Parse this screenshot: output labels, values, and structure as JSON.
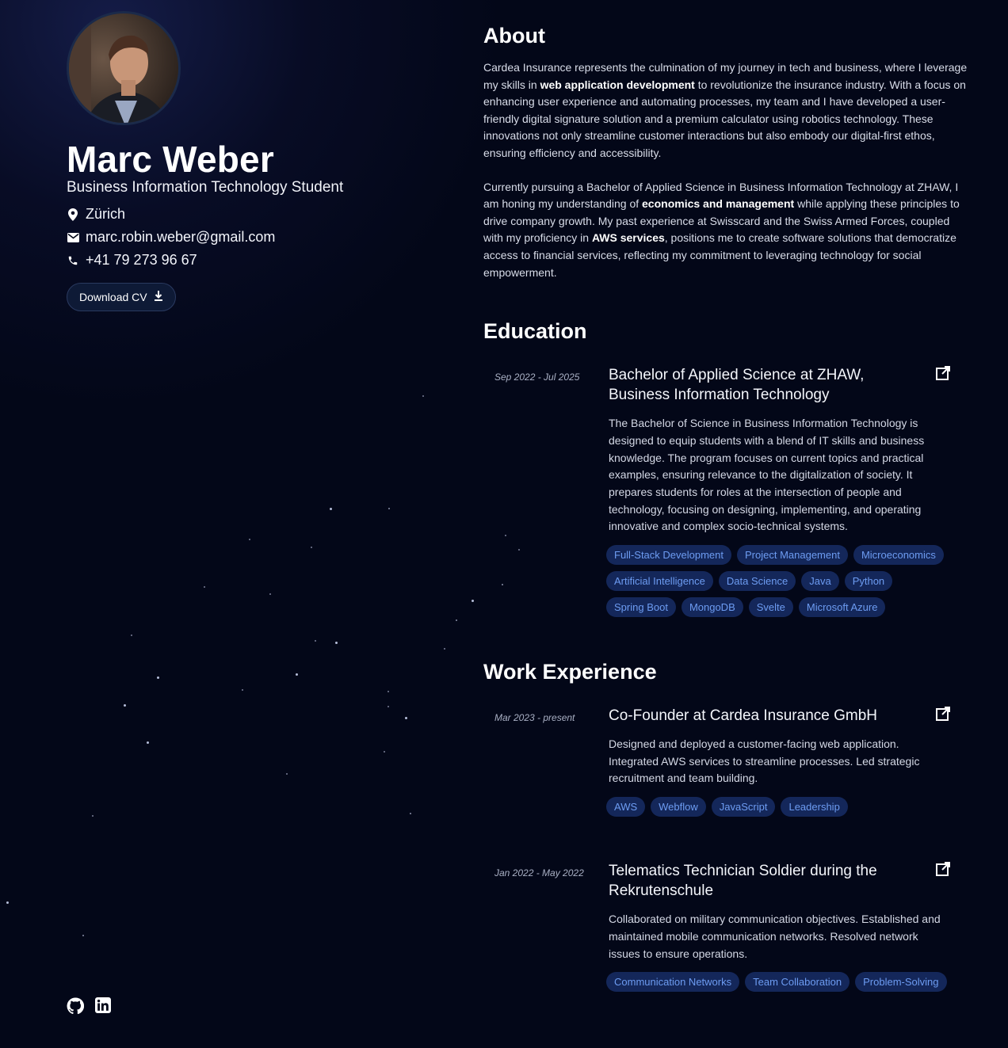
{
  "profile": {
    "name": "Marc Weber",
    "subtitle": "Business Information Technology Student",
    "location": "Zürich",
    "email": "marc.robin.weber@gmail.com",
    "phone": "+41 79 273 96 67",
    "download_label": "Download CV",
    "icons": {
      "location": "map-pin-icon",
      "email": "mail-icon",
      "phone": "phone-icon",
      "download": "download-icon"
    }
  },
  "socials": [
    {
      "icon": "github-icon"
    },
    {
      "icon": "linkedin-icon"
    }
  ],
  "about": {
    "heading": "About",
    "p1_a": "Cardea Insurance represents the culmination of my journey in tech and business, where I leverage my skills in ",
    "p1_b": "web application development",
    "p1_c": " to revolutionize the insurance industry. With a focus on enhancing user experience and automating processes, my team and I have developed a user-friendly digital signature solution and a premium calculator using robotics technology. These innovations not only streamline customer interactions but also embody our digital-first ethos, ensuring efficiency and accessibility.",
    "p2_a": "Currently pursuing a Bachelor of Applied Science in Business Information Technology at ZHAW, I am honing my understanding of ",
    "p2_b": "economics and management",
    "p2_c": " while applying these principles to drive company growth. My past experience at Swisscard and the Swiss Armed Forces, coupled with my proficiency in ",
    "p2_d": "AWS services",
    "p2_e": ", positions me to create software solutions that democratize access to financial services, reflecting my commitment to leveraging technology for social empowerment."
  },
  "education": {
    "heading": "Education",
    "items": [
      {
        "date": "Sep 2022 - Jul 2025",
        "title": "Bachelor of Applied Science at ZHAW, Business Information Technology",
        "description": "The Bachelor of Science in Business Information Technology is designed to equip students with a blend of IT skills and business knowledge. The program focuses on current topics and practical examples, ensuring relevance to the digitalization of society. It prepares students for roles at the intersection of people and technology, focusing on designing, implementing, and operating innovative and complex socio-technical systems.",
        "tags": [
          "Full-Stack Development",
          "Project Management",
          "Microeconomics",
          "Artificial Intelligence",
          "Data Science",
          "Java",
          "Python",
          "Spring Boot",
          "MongoDB",
          "Svelte",
          "Microsoft Azure"
        ]
      }
    ]
  },
  "work": {
    "heading": "Work Experience",
    "items": [
      {
        "date": "Mar 2023 - present",
        "title": "Co-Founder at Cardea Insurance GmbH",
        "description": "Designed and deployed a customer-facing web application. Integrated AWS services to streamline processes. Led strategic recruitment and team building.",
        "tags": [
          "AWS",
          "Webflow",
          "JavaScript",
          "Leadership"
        ]
      },
      {
        "date": "Jan 2022 - May 2022",
        "title": "Telematics Technician Soldier during the Rekrutenschule",
        "description": "Collaborated on military communication objectives. Established and maintained mobile communication networks. Resolved network issues to ensure operations.",
        "tags": [
          "Communication Networks",
          "Team Collaboration",
          "Problem-Solving"
        ]
      }
    ]
  },
  "colors": {
    "background": "#030718",
    "tag_bg": "#14275a",
    "tag_text": "#6d9cf2"
  }
}
